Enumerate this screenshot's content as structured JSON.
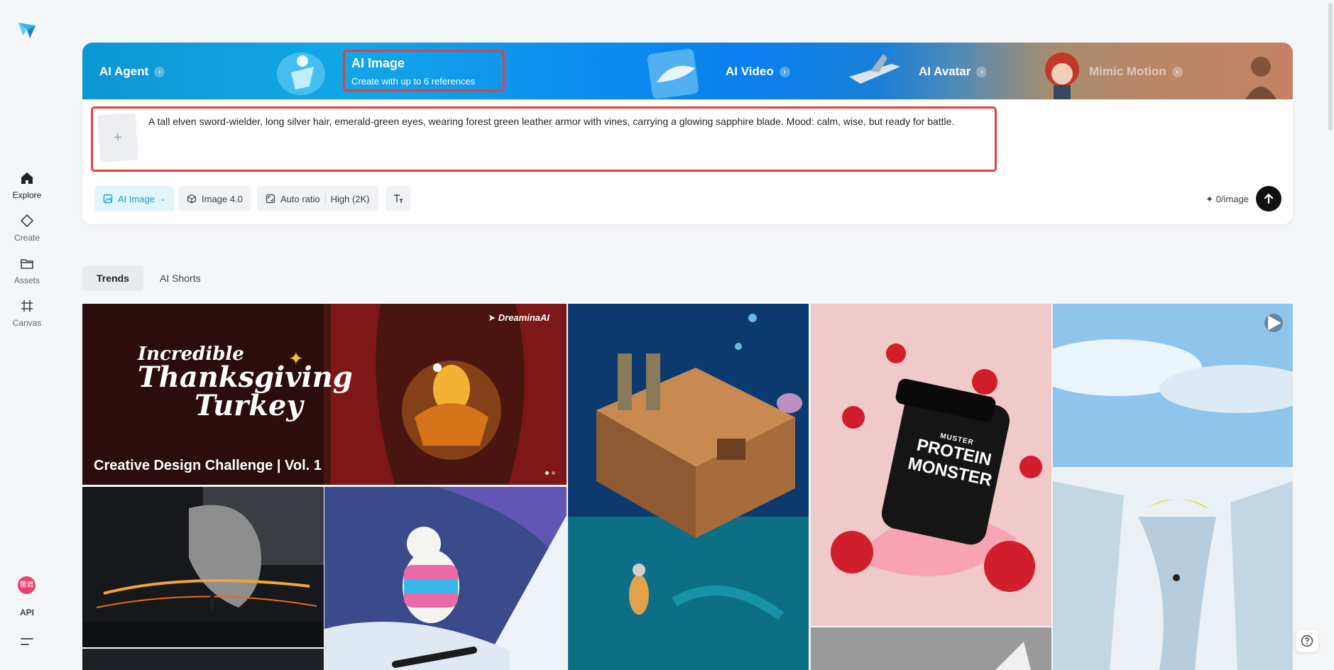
{
  "sidebar": {
    "nav": [
      {
        "label": "Explore",
        "icon": "home-icon"
      },
      {
        "label": "Create",
        "icon": "diamond-icon"
      },
      {
        "label": "Assets",
        "icon": "folder-icon"
      },
      {
        "label": "Canvas",
        "icon": "crop-icon"
      }
    ],
    "avatar_text": "蕾君",
    "api_label": "API"
  },
  "banner": {
    "agent": "AI Agent",
    "image_title": "AI Image",
    "image_subtitle": "Create with up to 6 references",
    "video": "AI Video",
    "avatar": "AI Avatar",
    "mimic": "Mimic Motion"
  },
  "prompt": {
    "text": "A tall elven sword-wielder, long silver hair, emerald-green eyes, wearing forest green leather armor with vines, carrying a glowing sapphire blade. Mood: calm, wise, but ready for battle.",
    "ref_add": "+"
  },
  "controls": {
    "mode": "AI Image",
    "model": "Image 4.0",
    "ratio": "Auto ratio",
    "quality": "High (2K)",
    "credit": "0/image"
  },
  "tabs": [
    "Trends",
    "AI Shorts"
  ],
  "gallery": {
    "featured_title": "Creative Design Challenge | Vol. 1",
    "featured_line1": "Incredible",
    "featured_line2": "Thanksgiving",
    "featured_line3": "Turkey",
    "brand": "DreaminaAI",
    "jar_brand": "MUSTER",
    "jar_line1": "PROTEIN",
    "jar_line2": "MONSTER"
  },
  "colors": {
    "accent": "#1aa2d8",
    "highlight": "#e3413b"
  }
}
